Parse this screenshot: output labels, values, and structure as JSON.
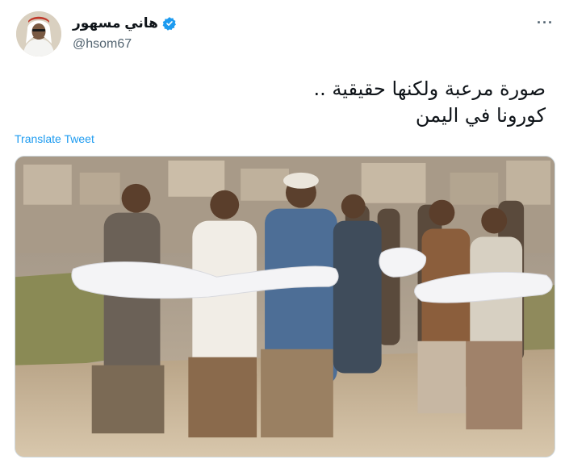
{
  "user": {
    "display_name": "هاني مسهور",
    "handle": "@hsom67",
    "verified": true
  },
  "tweet": {
    "lines": [
      "صورة مرعبة ولكنها حقيقية ..",
      "كورونا في اليمن"
    ],
    "translate_label": "Translate Tweet"
  },
  "icons": {
    "more": "more-options-icon",
    "verified": "verified-badge-icon"
  },
  "colors": {
    "link": "#1d9bf0",
    "secondary_text": "#536471",
    "primary_text": "#0f1419"
  },
  "more_glyph": "···"
}
